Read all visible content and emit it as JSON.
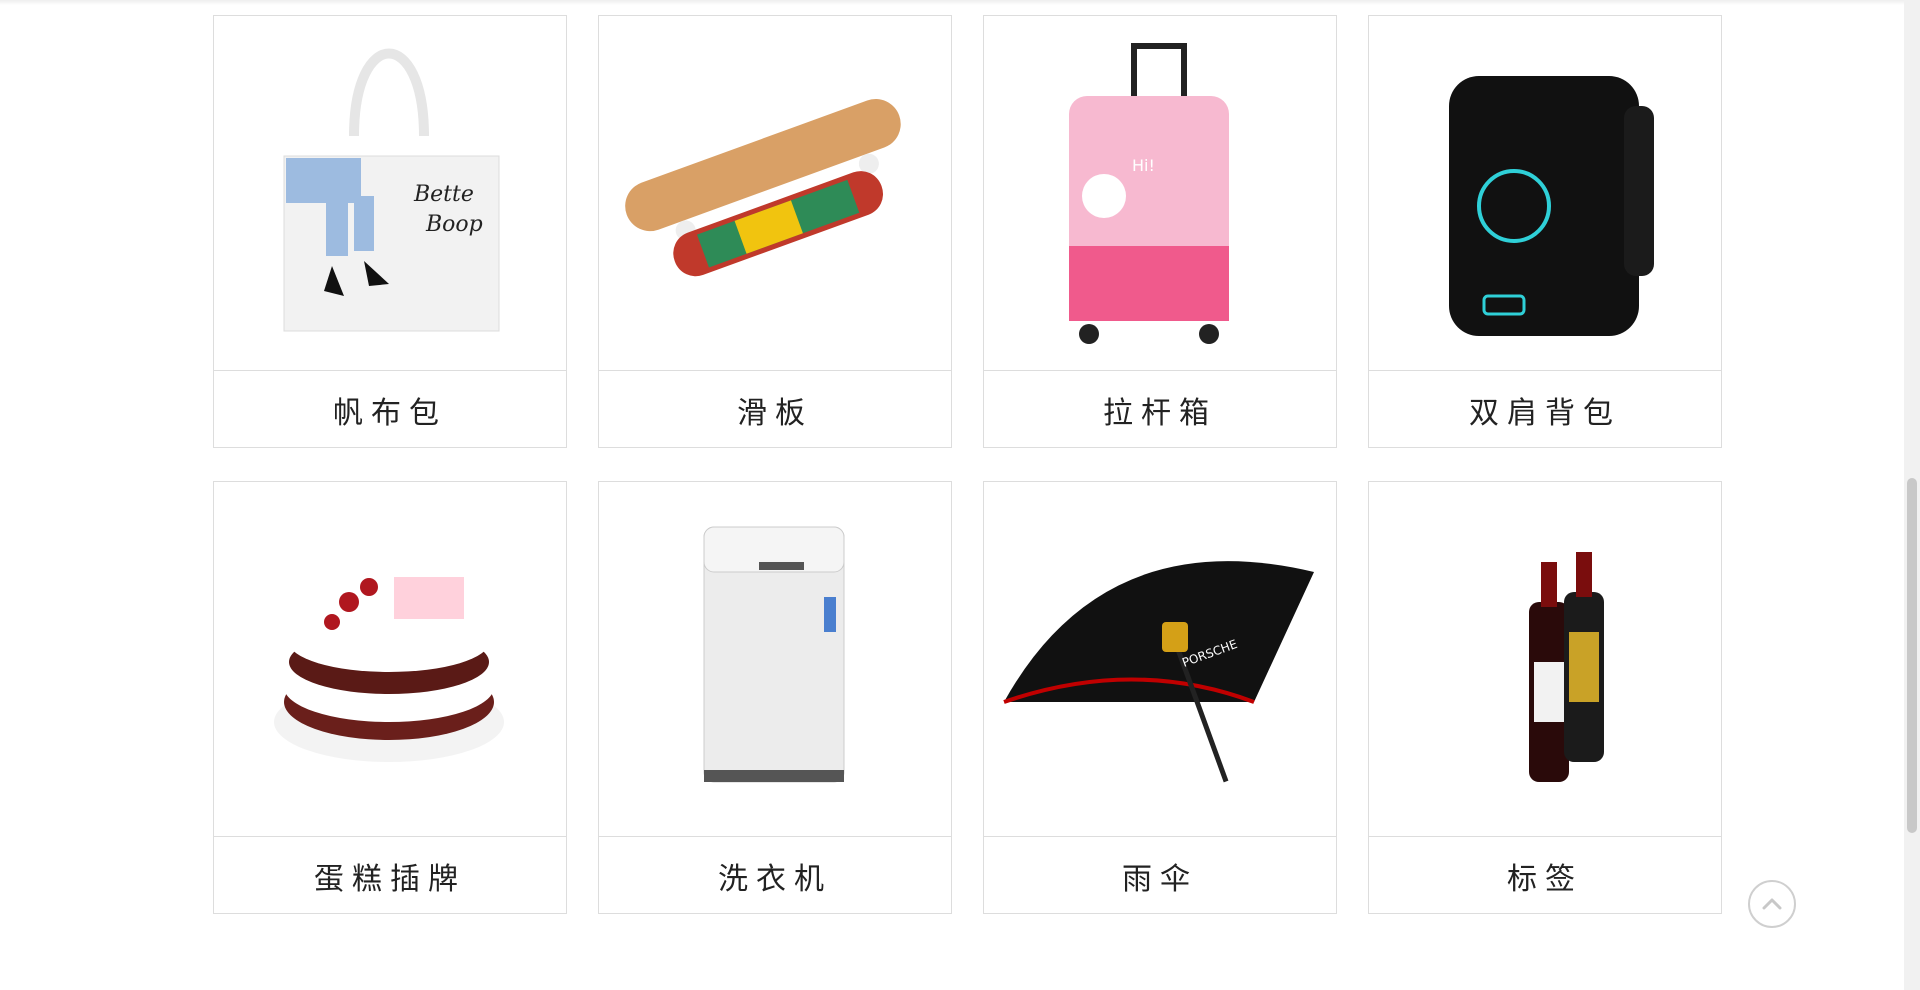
{
  "products": [
    {
      "name": "帆布包",
      "icon": "tote-bag-image"
    },
    {
      "name": "滑板",
      "icon": "skateboard-image"
    },
    {
      "name": "拉杆箱",
      "icon": "suitcase-image"
    },
    {
      "name": "双肩背包",
      "icon": "backpack-image"
    },
    {
      "name": "蛋糕插牌",
      "icon": "cake-image"
    },
    {
      "name": "洗衣机",
      "icon": "washing-machine-image"
    },
    {
      "name": "雨伞",
      "icon": "umbrella-image"
    },
    {
      "name": "标签",
      "icon": "wine-bottles-image"
    }
  ],
  "tote": {
    "text_line1": "Bette",
    "text_line2": "Boop"
  },
  "suitcase": {
    "tag": "Hi!"
  },
  "umbrella": {
    "brand": "PORSCHE"
  },
  "colors": {
    "border": "#dddddd",
    "text": "#222222"
  },
  "back_to_top": {
    "icon": "chevron-up-icon"
  }
}
